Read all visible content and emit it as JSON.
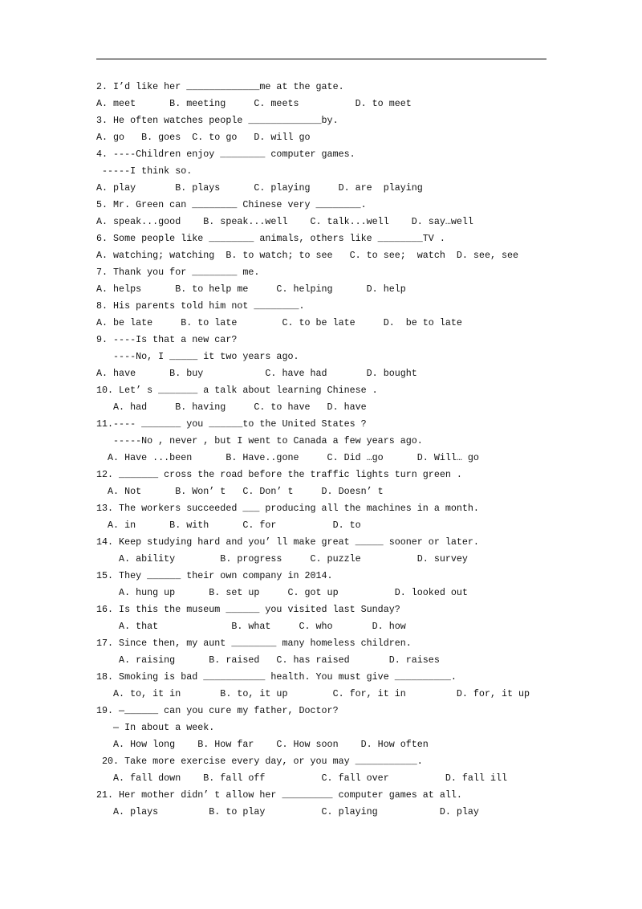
{
  "lines": [
    "2. I’d like her _____________me at the gate.",
    "A. meet      B. meeting     C. meets          D. to meet",
    "3. He often watches people _____________by.",
    "A. go   B. goes  C. to go   D. will go",
    "4. ----Children enjoy ________ computer games.",
    " -----I think so.",
    "A. play       B. plays      C. playing     D. are  playing",
    "5. Mr. Green can ________ Chinese very ________.",
    "A. speak...good    B. speak...well    C. talk...well    D. say…well",
    "6. Some people like ________ animals, others like ________TV .",
    "A. watching; watching  B. to watch; to see   C. to see;  watch  D. see, see",
    "7. Thank you for ________ me.",
    "A. helps      B. to help me     C. helping      D. help",
    "8. His parents told him not ________.",
    "A. be late     B. to late        C. to be late     D.  be to late",
    "9. ----Is that a new car?",
    "   ----No, I _____ it two years ago.",
    "A. have      B. buy           C. have had       D. bought",
    "10. Let’ s _______ a talk about learning Chinese .",
    "   A. had     B. having     C. to have   D. have",
    "11.---- _______ you ______to the United States ?",
    "   -----No , never , but I went to Canada a few years ago.",
    "  A. Have ...been      B. Have..gone     C. Did …go      D. Will… go",
    "12. _______ cross the road before the traffic lights turn green .",
    "  A. Not      B. Won’ t   C. Don’ t     D. Doesn’ t",
    "13. The workers succeeded ___ producing all the machines in a month.",
    "  A. in      B. with      C. for          D. to",
    "14. Keep studying hard and you’ ll make great _____ sooner or later.",
    "    A. ability        B. progress     C. puzzle          D. survey",
    "15. They ______ their own company in 2014.",
    "    A. hung up      B. set up     C. got up          D. looked out",
    "16. Is this the museum ______ you visited last Sunday?",
    "    A. that             B. what     C. who       D. how",
    "17. Since then, my aunt ________ many homeless children.",
    "    A. raising      B. raised   C. has raised       D. raises",
    "18. Smoking is bad ___________ health. You must give __________.",
    "   A. to, it in       B. to, it up        C. for, it in         D. for, it up",
    "19. —______ can you cure my father, Doctor?",
    "   — In about a week.",
    "   A. How long    B. How far    C. How soon    D. How often",
    " 20. Take more exercise every day, or you may ___________.",
    "   A. fall down    B. fall off          C. fall over          D. fall ill",
    "21. Her mother didn’ t allow her _________ computer games at all.",
    "   A. plays         B. to play          C. playing           D. play"
  ]
}
